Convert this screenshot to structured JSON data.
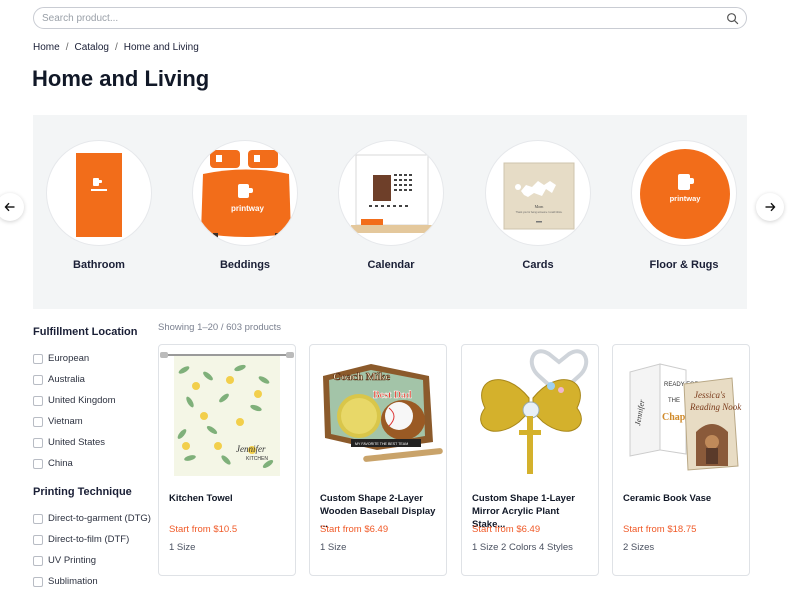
{
  "search": {
    "placeholder": "Search product...",
    "value": ""
  },
  "breadcrumb": {
    "items": [
      "Home",
      "Catalog",
      "Home and Living"
    ],
    "separator": "/"
  },
  "page_title": "Home and Living",
  "categories": [
    {
      "label": "Bathroom",
      "icon": "towel-image"
    },
    {
      "label": "Beddings",
      "icon": "bedding-image"
    },
    {
      "label": "Calendar",
      "icon": "calendar-image"
    },
    {
      "label": "Cards",
      "icon": "card-image"
    },
    {
      "label": "Floor & Rugs",
      "icon": "rug-image"
    }
  ],
  "brand_text": "printway",
  "filters": [
    {
      "heading": "Fulfillment Location",
      "options": [
        "European",
        "Australia",
        "United Kingdom",
        "Vietnam",
        "United States",
        "China"
      ]
    },
    {
      "heading": "Printing Technique",
      "options": [
        "Direct-to-garment (DTG)",
        "Direct-to-film (DTF)",
        "UV Printing",
        "Sublimation"
      ]
    }
  ],
  "results": {
    "showing": "Showing 1–20 / 603 products"
  },
  "products": [
    {
      "name": "Kitchen Towel",
      "price": "Start from $10.5",
      "meta": "1 Size"
    },
    {
      "name": "Custom Shape 2-Layer Wooden Baseball Display ...",
      "price": "Start from $6.49",
      "meta": "1 Size"
    },
    {
      "name": "Custom Shape 1-Layer Mirror Acrylic Plant Stake...",
      "price": "Start from $6.49",
      "meta": "1 Size  2 Colors  4 Styles"
    },
    {
      "name": "Ceramic Book Vase",
      "price": "Start from $18.75",
      "meta": "2 Sizes"
    }
  ],
  "product_image_text": {
    "towel": "Jennifer",
    "towel_sub": "KITCHEN",
    "baseball_top": "Coach Mike",
    "baseball_mid": "Best Dad",
    "baseball_bottom": "MY FAVORITE THE BEST TEAM",
    "book_spine": "Jennifer",
    "book_title_1": "Jessica's",
    "book_title_2": "Reading Nook",
    "book_front_1": "READY FOR",
    "book_front_2": "THE",
    "book_front_3": "Chapter",
    "card_inside": "Mom",
    "card_inside_sub": "Thank you for being someone I could follow."
  },
  "colors": {
    "accent": "#f05a28",
    "brand_orange": "#f26d1a",
    "panel_bg": "#f3f5f6",
    "text": "#1a1f36"
  }
}
